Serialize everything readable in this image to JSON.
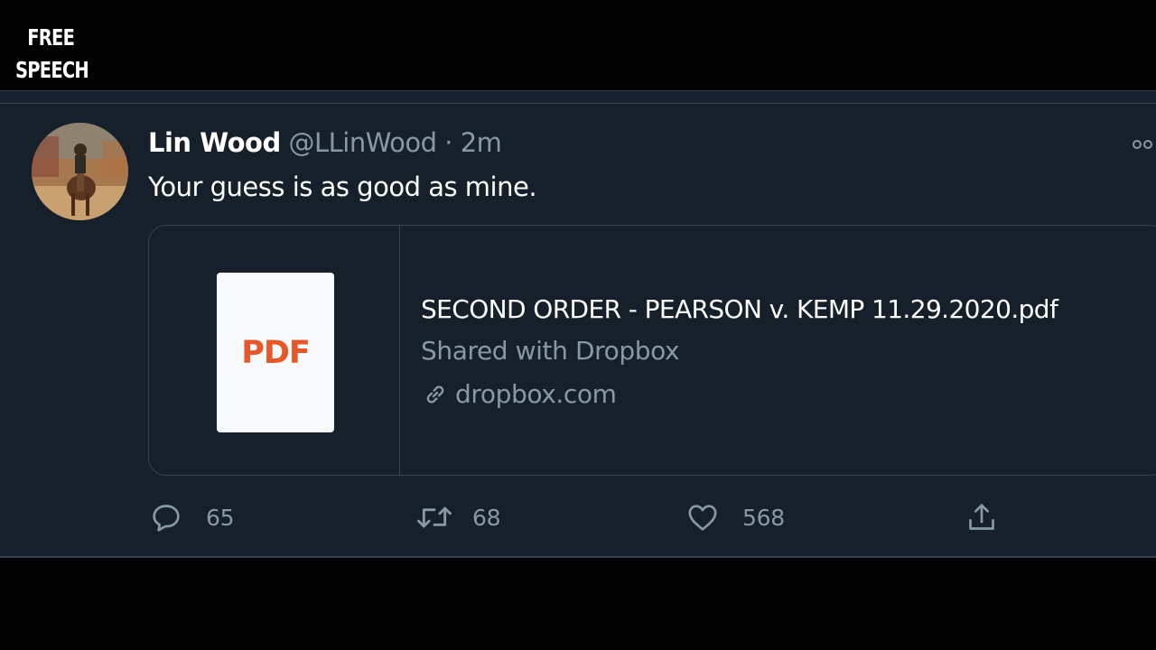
{
  "watermark": {
    "line1": "FREE",
    "line2": "SPEECH"
  },
  "tweet": {
    "display_name": "Lin Wood",
    "handle": "@LLinWood",
    "separator": "·",
    "time": "2m",
    "text": "Your guess is as good as mine.",
    "avatar_icon": "horse-rider-avatar"
  },
  "card": {
    "thumb_label": "PDF",
    "title": "SECOND ORDER - PEARSON v. KEMP 11.29.2020.pdf",
    "description": "Shared with Dropbox",
    "domain": "dropbox.com",
    "domain_icon": "link-icon"
  },
  "actions": {
    "reply_count": "65",
    "retweet_count": "68",
    "like_count": "568"
  },
  "colors": {
    "background": "#15202b",
    "text_primary": "#ffffff",
    "text_secondary": "#8899a6",
    "border": "#38444d",
    "pdf_accent": "#e8572a"
  }
}
